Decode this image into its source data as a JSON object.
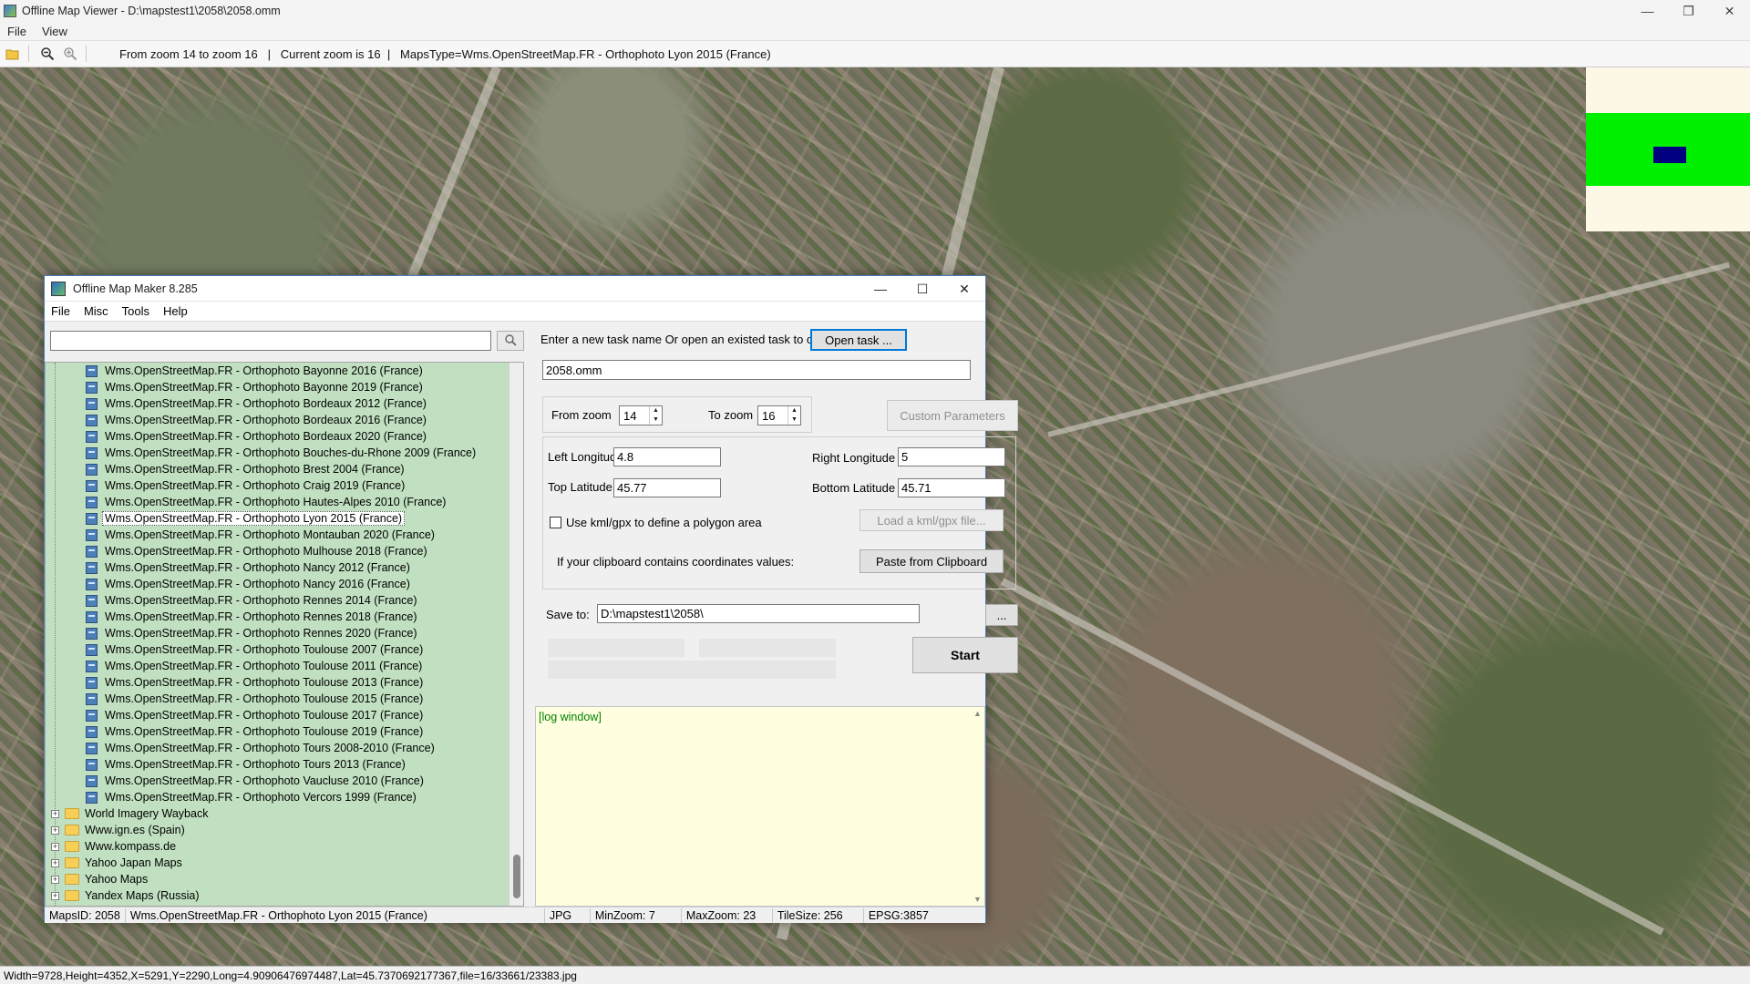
{
  "window": {
    "title": "Offline Map Viewer - D:\\mapstest1\\2058\\2058.omm",
    "menu": [
      "File",
      "View"
    ]
  },
  "toolbar": {
    "info": "From zoom 14 to zoom 16   |   Current zoom is 16  |   MapsType=Wms.OpenStreetMap.FR - Orthophoto Lyon 2015 (France)"
  },
  "bottom_status": "Width=9728,Height=4352,X=5291,Y=2290,Long=4.90906476974487,Lat=45.7370692177367,file=16/33661/23383.jpg",
  "dialog": {
    "title": "Offline Map Maker 8.285",
    "menu": [
      "File",
      "Misc",
      "Tools",
      "Help"
    ],
    "search_placeholder": "",
    "tree_items": [
      "Wms.OpenStreetMap.FR - Orthophoto Bayonne 2016 (France)",
      "Wms.OpenStreetMap.FR - Orthophoto Bayonne 2019 (France)",
      "Wms.OpenStreetMap.FR - Orthophoto Bordeaux 2012 (France)",
      "Wms.OpenStreetMap.FR - Orthophoto Bordeaux 2016 (France)",
      "Wms.OpenStreetMap.FR - Orthophoto Bordeaux 2020 (France)",
      "Wms.OpenStreetMap.FR - Orthophoto Bouches-du-Rhone 2009 (France)",
      "Wms.OpenStreetMap.FR - Orthophoto Brest 2004 (France)",
      "Wms.OpenStreetMap.FR - Orthophoto Craig 2019 (France)",
      "Wms.OpenStreetMap.FR - Orthophoto Hautes-Alpes 2010 (France)",
      "Wms.OpenStreetMap.FR - Orthophoto Lyon 2015 (France)",
      "Wms.OpenStreetMap.FR - Orthophoto Montauban 2020 (France)",
      "Wms.OpenStreetMap.FR - Orthophoto Mulhouse 2018 (France)",
      "Wms.OpenStreetMap.FR - Orthophoto Nancy 2012 (France)",
      "Wms.OpenStreetMap.FR - Orthophoto Nancy 2016 (France)",
      "Wms.OpenStreetMap.FR - Orthophoto Rennes 2014 (France)",
      "Wms.OpenStreetMap.FR - Orthophoto Rennes 2018 (France)",
      "Wms.OpenStreetMap.FR - Orthophoto Rennes 2020 (France)",
      "Wms.OpenStreetMap.FR - Orthophoto Toulouse 2007 (France)",
      "Wms.OpenStreetMap.FR - Orthophoto Toulouse 2011 (France)",
      "Wms.OpenStreetMap.FR - Orthophoto Toulouse 2013 (France)",
      "Wms.OpenStreetMap.FR - Orthophoto Toulouse 2015 (France)",
      "Wms.OpenStreetMap.FR - Orthophoto Toulouse 2017 (France)",
      "Wms.OpenStreetMap.FR - Orthophoto Toulouse 2019 (France)",
      "Wms.OpenStreetMap.FR - Orthophoto Tours 2008-2010 (France)",
      "Wms.OpenStreetMap.FR - Orthophoto Tours 2013 (France)",
      "Wms.OpenStreetMap.FR - Orthophoto Vaucluse 2010 (France)",
      "Wms.OpenStreetMap.FR - Orthophoto Vercors 1999 (France)"
    ],
    "selected_item": "Wms.OpenStreetMap.FR - Orthophoto Lyon 2015 (France)",
    "tree_folders": [
      "World Imagery Wayback",
      "Www.ign.es (Spain)",
      "Www.kompass.de",
      "Yahoo Japan Maps",
      "Yahoo Maps",
      "Yandex Maps (Russia)"
    ],
    "task_prompt": "Enter a new task name Or open an existed task to continue:",
    "open_task_label": "Open task ...",
    "task_name": "2058.omm",
    "from_zoom_label": "From zoom",
    "from_zoom": "14",
    "to_zoom_label": "To zoom",
    "to_zoom": "16",
    "custom_params_label": "Custom Parameters",
    "left_lon_label": "Left Longitude",
    "left_lon": "4.8",
    "right_lon_label": "Right Longitude",
    "right_lon": "5",
    "top_lat_label": "Top Latitude",
    "top_lat": "45.77",
    "bottom_lat_label": "Bottom Latitude",
    "bottom_lat": "45.71",
    "kml_label": "Use kml/gpx to define a polygon area",
    "load_kml_label": "Load a kml/gpx file...",
    "clipboard_label": "If your clipboard contains coordinates values:",
    "paste_label": "Paste from Clipboard",
    "save_to_label": "Save to:",
    "save_to": "D:\\mapstest1\\2058\\",
    "browse_label": "...",
    "start_label": "Start",
    "log_text": "[log window]",
    "status": {
      "maps_id": "MapsID: 2058",
      "maps_name": "Wms.OpenStreetMap.FR - Orthophoto Lyon 2015 (France)",
      "format": "JPG",
      "min_zoom": "MinZoom: 7",
      "max_zoom": "MaxZoom: 23",
      "tile_size": "TileSize: 256",
      "epsg": "EPSG:3857"
    }
  },
  "colors": {
    "tree_bg": "#c1e0c1",
    "log_bg": "#ffffe0",
    "minimap_band": "#00f000",
    "minimap_view": "#000080",
    "accent": "#0078d7"
  }
}
